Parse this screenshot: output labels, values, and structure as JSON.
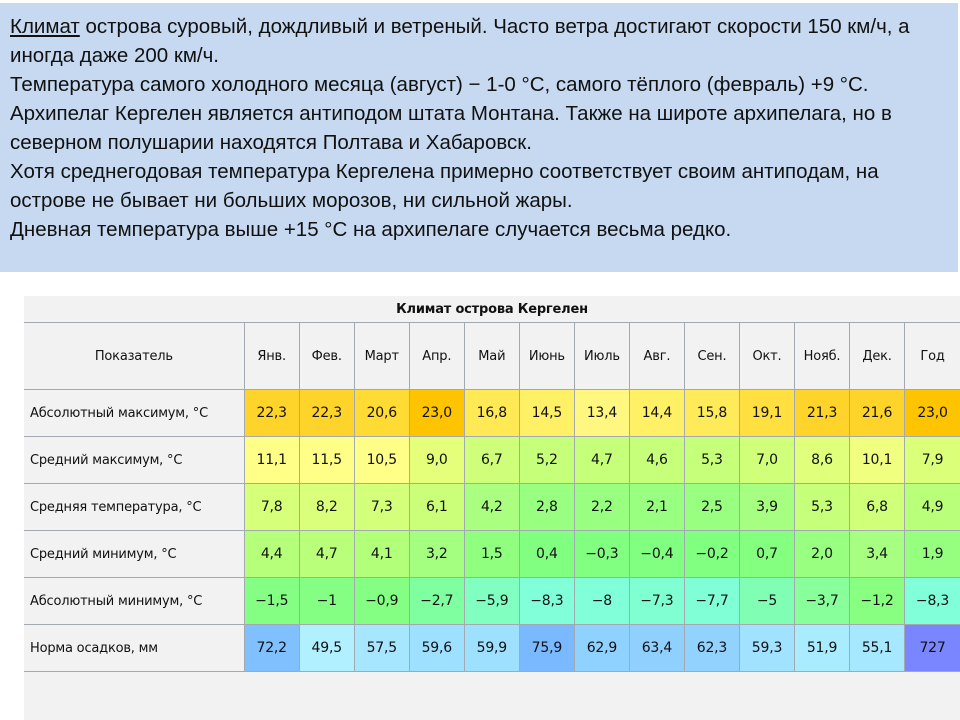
{
  "intro": {
    "paragraphs": [
      {
        "link": "Климат",
        "text": " острова суровый, дождливый и ветреный. Часто ветра достигают скорости 150 км/ч, а иногда даже 200 км/ч."
      },
      {
        "text": "Температура самого холодного месяца (август) − 1-0 °C, самого тёплого (февраль) +9 °C."
      },
      {
        "text": "Архипелаг Кергелен является антиподом штата Монтана. Также на широте архипелага, но в северном полушарии находятся Полтава и Хабаровск."
      },
      {
        "text": "Хотя среднегодовая температура Кергелена примерно соответствует своим антиподам, на острове не бывает ни больших морозов, ни сильной жары."
      },
      {
        "text": "Дневная температура выше +15 °C на архипелаге случается весьма редко."
      }
    ]
  },
  "table": {
    "title": "Климат острова Кергелен",
    "headers": [
      "Показатель",
      "Янв.",
      "Фев.",
      "Март",
      "Апр.",
      "Май",
      "Июнь",
      "Июль",
      "Авг.",
      "Сен.",
      "Окт.",
      "Нояб.",
      "Дек.",
      "Год"
    ],
    "rows": [
      {
        "label": "Абсолютный максимум, °C",
        "values": [
          "22,3",
          "22,3",
          "20,6",
          "23,0",
          "16,8",
          "14,5",
          "13,4",
          "14,4",
          "15,8",
          "19,1",
          "21,3",
          "21,6",
          "23,0"
        ],
        "colors": [
          "#ffd42a",
          "#ffd42a",
          "#ffdb33",
          "#ffc400",
          "#ffea55",
          "#fff066",
          "#fff780",
          "#fff066",
          "#ffeb5a",
          "#ffe040",
          "#ffd42a",
          "#ffd42a",
          "#ffc400"
        ]
      },
      {
        "label": "Средний максимум, °C",
        "values": [
          "11,1",
          "11,5",
          "10,5",
          "9,0",
          "6,7",
          "5,2",
          "4,7",
          "4,6",
          "5,3",
          "7,0",
          "8,6",
          "10,1",
          "7,9"
        ],
        "colors": [
          "#ffff88",
          "#ffff88",
          "#ffff88",
          "#e6ff7a",
          "#cfff7a",
          "#c6ff7a",
          "#c6ff7a",
          "#c6ff7a",
          "#c6ff7a",
          "#d0ff7a",
          "#e0ff7a",
          "#f0ff80",
          "#dcff7a"
        ]
      },
      {
        "label": "Средняя температура, °C",
        "values": [
          "7,8",
          "8,2",
          "7,3",
          "6,1",
          "4,2",
          "2,8",
          "2,2",
          "2,1",
          "2,5",
          "3,9",
          "5,3",
          "6,8",
          "4,9"
        ],
        "colors": [
          "#d6ff7a",
          "#daff7a",
          "#d4ff7a",
          "#cbff7a",
          "#aaff80",
          "#98ff80",
          "#98ff80",
          "#98ff80",
          "#98ff80",
          "#a6ff80",
          "#c6ff7a",
          "#d0ff7a",
          "#baff7a"
        ]
      },
      {
        "label": "Средний минимум, °C",
        "values": [
          "4,4",
          "4,7",
          "4,1",
          "3,2",
          "1,5",
          "0,4",
          "−0,3",
          "−0,4",
          "−0,2",
          "0,7",
          "2,0",
          "3,4",
          "1,9"
        ],
        "colors": [
          "#b6ff7a",
          "#baff7a",
          "#b2ff7a",
          "#a4ff80",
          "#90ff80",
          "#80ff80",
          "#80ff80",
          "#80ff80",
          "#80ff80",
          "#84ff80",
          "#98ff80",
          "#a6ff80",
          "#96ff80"
        ]
      },
      {
        "label": "Абсолютный минимум, °C",
        "values": [
          "−1,5",
          "−1",
          "−0,9",
          "−2,7",
          "−5,9",
          "−8,3",
          "−8",
          "−7,3",
          "−7,7",
          "−5",
          "−3,7",
          "−1,2",
          "−8,3"
        ],
        "colors": [
          "#84ff84",
          "#84ff84",
          "#84ff84",
          "#80ffa0",
          "#80ffc0",
          "#80ffd8",
          "#80ffd8",
          "#80ffd2",
          "#80ffd6",
          "#80ffb4",
          "#88ff9a",
          "#88ff80",
          "#80ffd8"
        ]
      },
      {
        "label": "Норма осадков, мм",
        "values": [
          "72,2",
          "49,5",
          "57,5",
          "59,6",
          "59,9",
          "75,9",
          "62,9",
          "63,4",
          "62,3",
          "59,3",
          "51,9",
          "55,1",
          "727"
        ],
        "colors": [
          "#80c0ff",
          "#b0f0ff",
          "#a6e6ff",
          "#9ee0ff",
          "#9ee0ff",
          "#7ab8ff",
          "#90d2ff",
          "#90d0ff",
          "#92d2ff",
          "#a0e2ff",
          "#aaecff",
          "#a6e8ff",
          "#7a86ff"
        ]
      }
    ]
  }
}
